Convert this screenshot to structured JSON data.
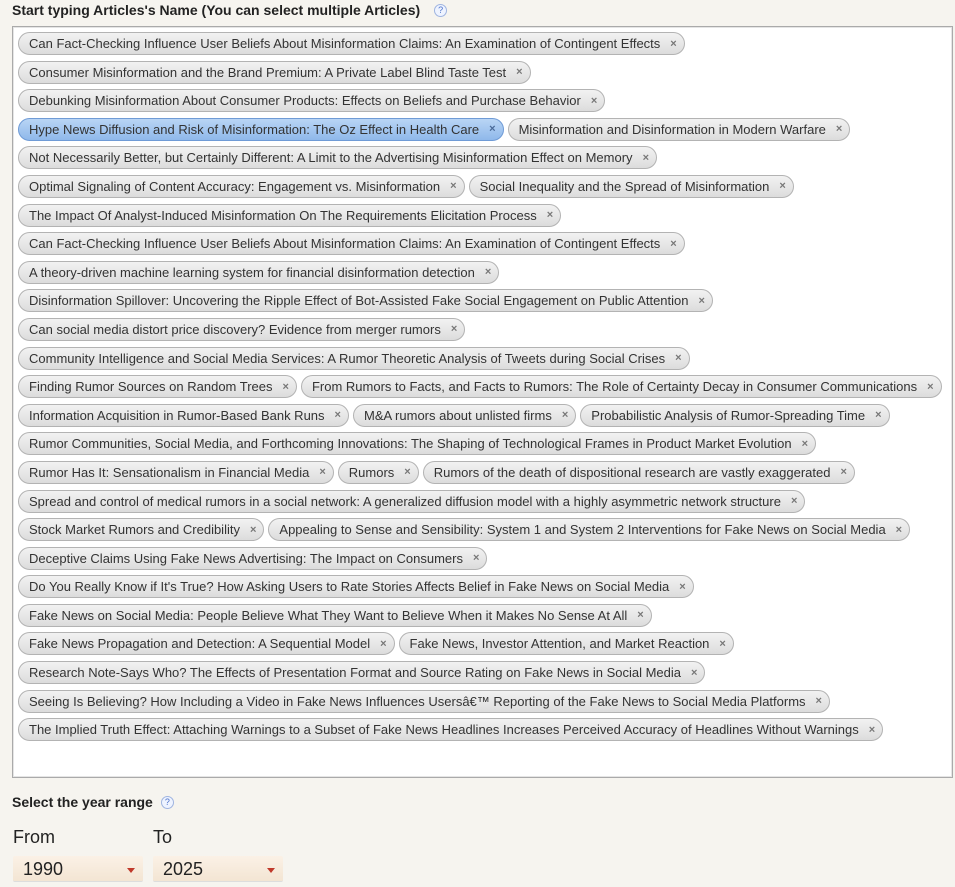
{
  "articles_field": {
    "label": "Start typing Articles's Name (You can select multiple Articles)",
    "help": "?"
  },
  "remove_glyph": "×",
  "selected_articles": [
    {
      "label": "Can Fact-Checking Influence User Beliefs About Misinformation Claims: An Examination of Contingent Effects"
    },
    {
      "label": "Consumer Misinformation and the Brand Premium: A Private Label Blind Taste Test"
    },
    {
      "label": "Debunking Misinformation About Consumer Products: Effects on Beliefs and Purchase Behavior"
    },
    {
      "label": "Hype News Diffusion and Risk of Misinformation: The Oz Effect in Health Care",
      "highlighted": true
    },
    {
      "label": "Misinformation and Disinformation in Modern Warfare"
    },
    {
      "label": "Not Necessarily Better, but Certainly Different: A Limit to the Advertising Misinformation Effect on Memory"
    },
    {
      "label": "Optimal Signaling of Content Accuracy: Engagement vs. Misinformation"
    },
    {
      "label": "Social Inequality and the Spread of Misinformation"
    },
    {
      "label": "The Impact Of Analyst-Induced Misinformation On The Requirements Elicitation Process"
    },
    {
      "label": "Can Fact-Checking Influence User Beliefs About Misinformation Claims: An Examination of Contingent Effects"
    },
    {
      "label": "A theory-driven machine learning system for financial disinformation detection"
    },
    {
      "label": "Disinformation Spillover: Uncovering the Ripple Effect of Bot-Assisted Fake Social Engagement on Public Attention"
    },
    {
      "label": "Can social media distort price discovery? Evidence from merger rumors"
    },
    {
      "label": "Community Intelligence and Social Media Services: A Rumor Theoretic Analysis of Tweets during Social Crises"
    },
    {
      "label": "Finding Rumor Sources on Random Trees"
    },
    {
      "label": "From Rumors to Facts, and Facts to Rumors: The Role of Certainty Decay in Consumer Communications"
    },
    {
      "label": "Information Acquisition in Rumor-Based Bank Runs"
    },
    {
      "label": "M&A rumors about unlisted firms"
    },
    {
      "label": "Probabilistic Analysis of Rumor-Spreading Time"
    },
    {
      "label": "Rumor Communities, Social Media, and Forthcoming Innovations: The Shaping of Technological Frames in Product Market Evolution"
    },
    {
      "label": "Rumor Has It: Sensationalism in Financial Media"
    },
    {
      "label": "Rumors"
    },
    {
      "label": "Rumors of the death of dispositional research are vastly exaggerated"
    },
    {
      "label": "Spread and control of medical rumors in a social network: A generalized diffusion model with a highly asymmetric network structure"
    },
    {
      "label": "Stock Market Rumors and Credibility"
    },
    {
      "label": "Appealing to Sense and Sensibility: System 1 and System 2 Interventions for Fake News on Social Media"
    },
    {
      "label": "Deceptive Claims Using Fake News Advertising: The Impact on Consumers"
    },
    {
      "label": "Do You Really Know if It's True? How Asking Users to Rate Stories Affects Belief in Fake News on Social Media"
    },
    {
      "label": "Fake News on Social Media: People Believe What They Want to Believe When it Makes No Sense At All"
    },
    {
      "label": "Fake News Propagation and Detection: A Sequential Model"
    },
    {
      "label": "Fake News, Investor Attention, and Market Reaction"
    },
    {
      "label": "Research Note-Says Who? The Effects of Presentation Format and Source Rating on Fake News in Social Media"
    },
    {
      "label": "Seeing Is Believing? How Including a Video in Fake News Influences Usersâ€™ Reporting of the Fake News to Social Media Platforms"
    },
    {
      "label": "The Implied Truth Effect: Attaching Warnings to a Subset of Fake News Headlines Increases Perceived Accuracy of Headlines Without Warnings"
    }
  ],
  "year_range": {
    "label": "Select the year range",
    "help": "?",
    "from_label": "From",
    "to_label": "To",
    "from_value": "1990",
    "to_value": "2025"
  },
  "colors": {
    "chip_highlight": "#9cc0ee",
    "dropdown_caret": "#c0392b"
  }
}
